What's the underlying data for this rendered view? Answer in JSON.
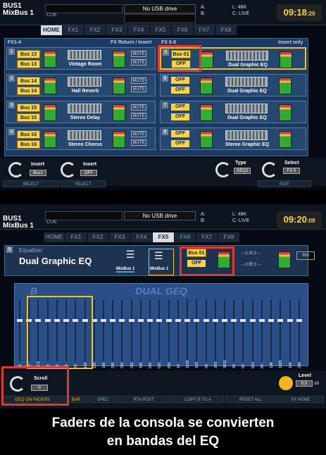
{
  "screen1": {
    "bus_label": "BUS1",
    "bus_sub": "MixBus 1",
    "cue_label": "CUE",
    "usb_status": "No USB drive",
    "meter_a": "A:",
    "meter_b": "B:",
    "meter_l": "L: 48K",
    "meter_c": "C: LIVE",
    "clock_main": "09:18",
    "clock_sec": ":20",
    "tabs": [
      "HOME",
      "FX1",
      "FX2",
      "FX3",
      "FX4",
      "FX5",
      "FX6",
      "FX7",
      "FX8"
    ],
    "left_header": "FX1-4",
    "left_header_right": "FX Return / Insert",
    "right_header": "FX 5-8",
    "right_header_right": "Insert only",
    "left_slots": [
      {
        "num": "1",
        "bus_top": "Bus 13",
        "bus_bottom": "Bus 13",
        "name": "Vintage Room",
        "mute": "MUTE"
      },
      {
        "num": "2",
        "bus_top": "Bus 14",
        "bus_bottom": "Bus 14",
        "name": "Hall Reverb",
        "mute": "MUTE"
      },
      {
        "num": "3",
        "bus_top": "Bus 15",
        "bus_bottom": "Bus 15",
        "name": "Stereo Delay",
        "mute": "MUTE"
      },
      {
        "num": "4",
        "bus_top": "Bus 16",
        "bus_bottom": "Bus 16",
        "name": "Stereo Chorus",
        "mute": "MUTE"
      }
    ],
    "right_slots": [
      {
        "num": "5",
        "top": "Bus 01",
        "bottom": "OFF",
        "name": "Dual Graphic EQ"
      },
      {
        "num": "6",
        "top": "OFF",
        "bottom": "OFF",
        "name": "Dual Graphic EQ"
      },
      {
        "num": "7",
        "top": "OFF",
        "bottom": "OFF",
        "name": "Dual Graphic EQ"
      },
      {
        "num": "8",
        "top": "OFF",
        "bottom": "OFF",
        "name": "Stereo Graphic EQ"
      }
    ],
    "knob1_label": "Insert",
    "knob1_val": "Bus1",
    "knob2_label": "Insert",
    "knob2_val": "OFF",
    "knob3_label": "Type",
    "knob3_val": "GEQ2",
    "knob4_label": "Select",
    "knob4_val": "FX 5",
    "softkey1": "SELECT",
    "softkey2": "SELECT",
    "softkey3": "EDIT"
  },
  "screen2": {
    "bus_label": "BUS1",
    "bus_sub": "MixBus 1",
    "cue_label": "CUE",
    "usb_status": "No USB drive",
    "meter_a": "A:",
    "meter_b": "B:",
    "meter_l": "L: 48K",
    "meter_c": "C: LIVE",
    "clock_main": "09:20",
    "clock_sec": ":09",
    "tabs": [
      "HOME",
      "FX1",
      "FX2",
      "FX3",
      "FX4",
      "FX5",
      "FX6",
      "FX7",
      "FX8"
    ],
    "slot_num": "5",
    "eq_label": "Equalizer",
    "eq_name": "Dual Graphic EQ",
    "mix1": "MixBus 1",
    "mix2": "MixBus 1",
    "bus_top": "Bus 01",
    "bus_bottom": "OFF",
    "route_a": "A",
    "route_b": "B",
    "ins": "INS",
    "graph_title": "DUAL GEQ",
    "graph_b": "B",
    "bands": [
      "20",
      "25",
      "31.5",
      "40",
      "50",
      "63",
      "80",
      "100",
      "125",
      "160",
      "200",
      "250",
      "315",
      "400",
      "500",
      "630",
      "800",
      "1K",
      "1K25",
      "1K6",
      "2K",
      "2K5",
      "3K15",
      "4K",
      "5K",
      "6K3",
      "8K",
      "10K",
      "12K5",
      "16K",
      "20K"
    ],
    "scroll_label": "Scroll",
    "scroll_val": "0",
    "level_label": "Level",
    "level_val": "0.0",
    "level_unit": "dB",
    "softkeys": [
      "GEQ ON FADERS",
      "BAR",
      "SPEC",
      "RTA POST",
      "COPY B TO A",
      "RESET ALL",
      "FX HOME"
    ]
  },
  "caption_line1": "Faders de la consola se convierten",
  "caption_line2": "en bandas del EQ"
}
